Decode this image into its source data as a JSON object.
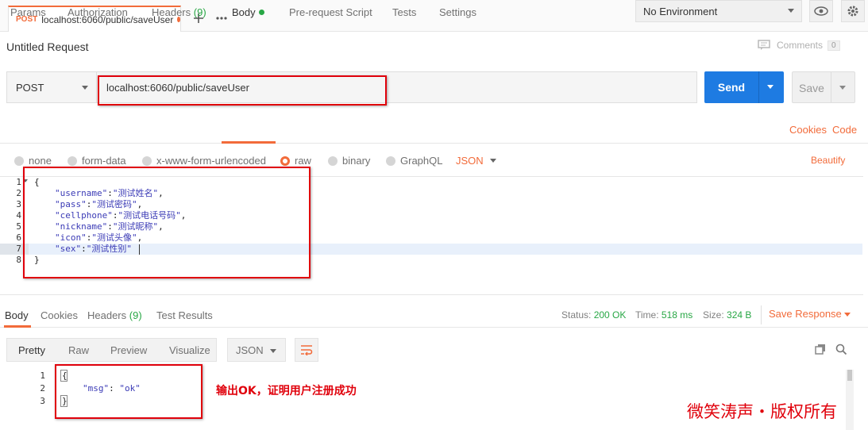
{
  "tab": {
    "method": "POST",
    "url": "localhost:6060/public/saveUser"
  },
  "environment": {
    "selected": "No Environment"
  },
  "request": {
    "title": "Untitled Request",
    "comments_label": "Comments",
    "comments_count": "0",
    "method": "POST",
    "url": "localhost:6060/public/saveUser",
    "send_label": "Send",
    "save_label": "Save"
  },
  "request_tabs": {
    "params": "Params",
    "authorization": "Authorization",
    "headers": "Headers",
    "headers_count": "(9)",
    "body": "Body",
    "prerequest": "Pre-request Script",
    "tests": "Tests",
    "settings": "Settings",
    "cookies": "Cookies",
    "code": "Code"
  },
  "body_types": {
    "none": "none",
    "form_data": "form-data",
    "urlencoded": "x-www-form-urlencoded",
    "raw": "raw",
    "binary": "binary",
    "graphql": "GraphQL",
    "format": "JSON",
    "beautify": "Beautify"
  },
  "request_body": {
    "line_numbers": [
      "1",
      "2",
      "3",
      "4",
      "5",
      "6",
      "7",
      "8"
    ],
    "open": "{",
    "close": "}",
    "fields": [
      {
        "key": "\"username\"",
        "value": "\"测试姓名\"",
        "sep": ","
      },
      {
        "key": "\"pass\"",
        "value": "\"测试密码\"",
        "sep": ","
      },
      {
        "key": "\"cellphone\"",
        "value": "\"测试电话号码\"",
        "sep": ","
      },
      {
        "key": "\"nickname\"",
        "value": "\"测试昵称\"",
        "sep": ","
      },
      {
        "key": "\"icon\"",
        "value": "\"测试头像\"",
        "sep": ","
      },
      {
        "key": "\"sex\"",
        "value": "\"测试性别\"",
        "sep": ""
      }
    ]
  },
  "response_tabs": {
    "body": "Body",
    "cookies": "Cookies",
    "headers": "Headers",
    "headers_count": "(9)",
    "test_results": "Test Results"
  },
  "response_status": {
    "status_label": "Status:",
    "status_value": "200 OK",
    "time_label": "Time:",
    "time_value": "518 ms",
    "size_label": "Size:",
    "size_value": "324 B",
    "save_response": "Save Response"
  },
  "response_toolbar": {
    "pretty": "Pretty",
    "raw": "Raw",
    "preview": "Preview",
    "visualize": "Visualize",
    "format": "JSON"
  },
  "response_body": {
    "line_numbers": [
      "1",
      "2",
      "3"
    ],
    "open": "{",
    "key": "\"msg\"",
    "value": "\"ok\"",
    "close": "}"
  },
  "annotation": "输出OK，证明用户注册成功",
  "watermark": "微笑涛声・版权所有",
  "colors": {
    "accent": "#f26b3a",
    "send": "#1e7be2",
    "success": "#28a745",
    "annotation": "#e0000b"
  }
}
